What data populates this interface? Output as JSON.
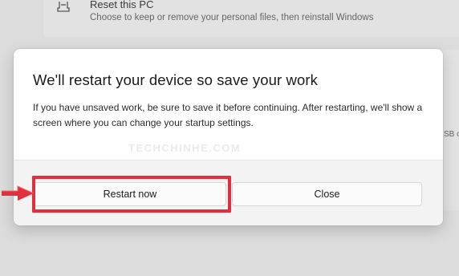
{
  "background": {
    "reset_title": "Reset this PC",
    "reset_description": "Choose to keep or remove your personal files, then reinstall Windows",
    "side_text": "SB c"
  },
  "dialog": {
    "title": "We'll restart your device so save your work",
    "body": "If you have unsaved work, be sure to save it before continuing. After restarting, we'll show a screen where you can change your startup settings.",
    "watermark": "TECHCHINHE.COM",
    "buttons": {
      "restart_label": "Restart now",
      "close_label": "Close"
    }
  },
  "annotation": {
    "highlight_color": "#e0303e",
    "arrow_color": "#e0303e",
    "arrow_icon": "red-arrow-icon"
  }
}
